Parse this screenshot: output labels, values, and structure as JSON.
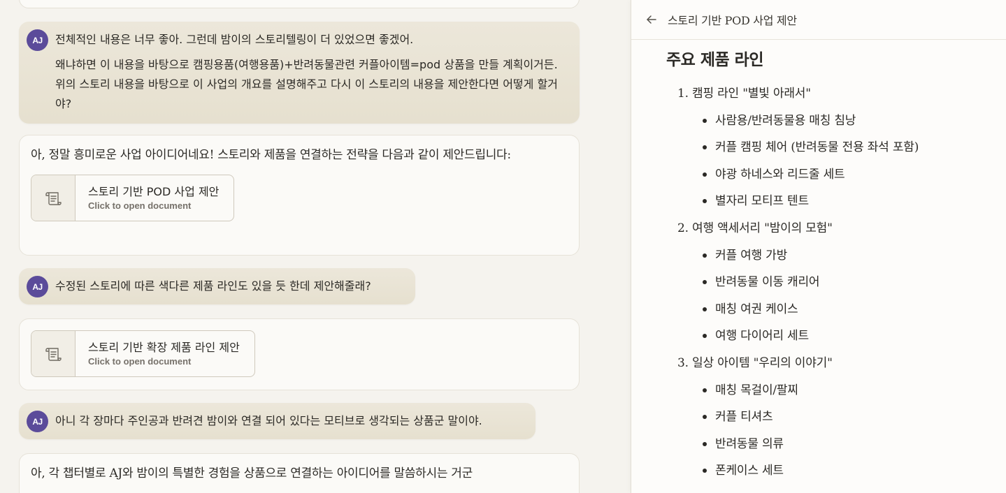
{
  "chat": {
    "messages": [
      {
        "role": "user",
        "avatar": "AJ",
        "paragraphs": [
          "전체적인 내용은 너무 좋아. 그런데 밤이의 스토리텔링이 더 있었으면 좋겠어.",
          "왜냐하면 이 내용을 바탕으로 캠핑용품(여행용품)+반려동물관련 커플아이템=pod 상품을 만들 계획이거든.  위의 스토리 내용을 바탕으로 이 사업의 개요를 설명해주고 다시 이 스토리의 내용을 제안한다면 어떻게 할거야?"
        ]
      },
      {
        "role": "assistant",
        "text": "아, 정말 흥미로운 사업 아이디어네요! 스토리와 제품을 연결하는 전략을 다음과 같이 제안드립니다:",
        "doc_title": "스토리 기반 POD 사업 제안",
        "doc_sub": "Click to open document"
      },
      {
        "role": "user",
        "avatar": "AJ",
        "text": "수정된 스토리에 따른 색다른 제품 라인도 있을 듯 한데 제안해줄래?"
      },
      {
        "role": "assistant",
        "doc_title": "스토리 기반 확장 제품 라인 제안",
        "doc_sub": "Click to open document"
      },
      {
        "role": "user",
        "avatar": "AJ",
        "text": "아니 각 장마다 주인공과 반려견 밤이와 연결 되어 있다는 모티브로 생각되는 상품군 말이야."
      },
      {
        "role": "assistant",
        "text": "아, 각 챕터별로 AJ와 밤이의 특별한 경험을 상품으로 연결하는 아이디어를 말씀하시는 거군"
      }
    ]
  },
  "panel": {
    "back_icon": "arrow-left-icon",
    "title": "스토리 기반 POD 사업 제안",
    "heading": "주요 제품 라인",
    "lines": [
      {
        "label": "1. 캠핑 라인 \"별빛 아래서\"",
        "items": [
          "사람용/반려동물용 매칭 침낭",
          "커플 캠핑 체어 (반려동물 전용 좌석 포함)",
          "야광 하네스와 리드줄 세트",
          "별자리 모티프 텐트"
        ]
      },
      {
        "label": "2. 여행 액세서리 \"밤이의 모험\"",
        "items": [
          "커플 여행 가방",
          "반려동물 이동 캐리어",
          "매칭 여권 케이스",
          "여행 다이어리 세트"
        ]
      },
      {
        "label": "3. 일상 아이템 \"우리의 이야기\"",
        "items": [
          "매칭 목걸이/팔찌",
          "커플 티셔츠",
          "반려동물 의류",
          "폰케이스 세트"
        ]
      }
    ]
  },
  "colors": {
    "avatar": "#5b4b9a",
    "user_bubble": "#e9e4d5",
    "background": "#f5f3ee"
  }
}
